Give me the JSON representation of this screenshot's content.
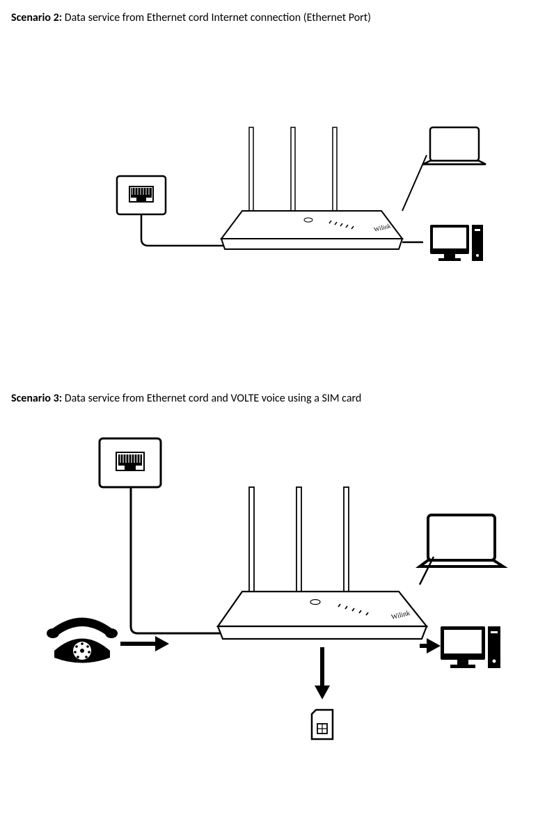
{
  "scenario2": {
    "label": "Scenario 2:",
    "text1": " Data service from ",
    "emph": "Ethernet cord",
    "text2": " Internet connection (Ethernet Port)"
  },
  "scenario3": {
    "label": "Scenario 3:",
    "text1": " Data service from ",
    "emph": "Ethernet cord",
    "text2": " and VOLTE voice using a SIM card"
  },
  "router_brand": "Wilink"
}
